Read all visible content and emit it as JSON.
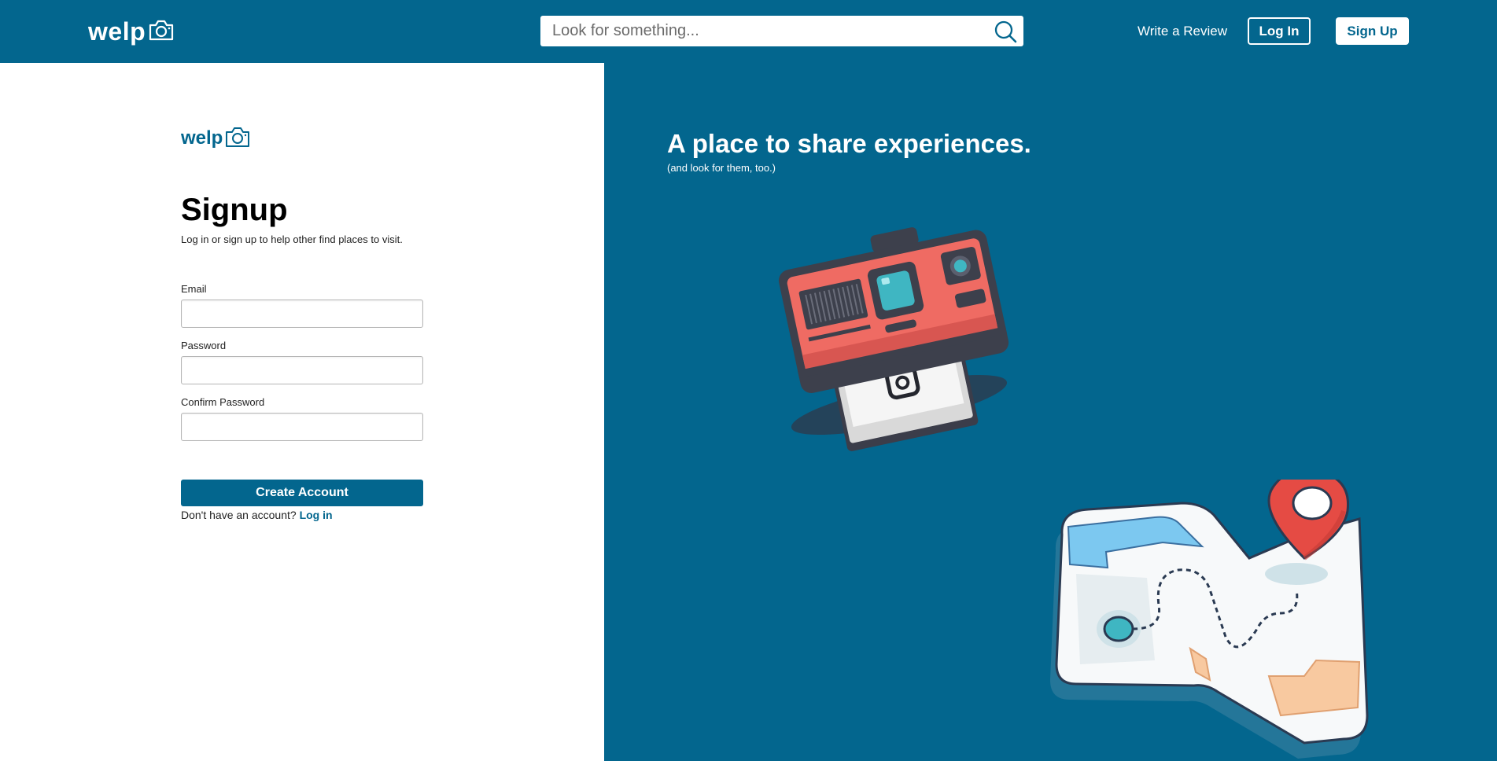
{
  "colors": {
    "brand": "#03668e",
    "white": "#ffffff"
  },
  "nav": {
    "logo": "welp",
    "logo_icon": "camera-icon",
    "search_placeholder": "Look for something...",
    "search_icon": "search-icon",
    "write_review": "Write a Review",
    "login": "Log In",
    "signup": "Sign Up"
  },
  "form": {
    "logo": "welp",
    "title": "Signup",
    "subtitle": "Log in or sign up to help other find places to visit.",
    "fields": [
      {
        "label": "Email",
        "value": ""
      },
      {
        "label": "Password",
        "value": ""
      },
      {
        "label": "Confirm Password",
        "value": ""
      }
    ],
    "submit": "Create Account",
    "no_account_text": "Don't have an account?",
    "login_link": "Log in"
  },
  "hero": {
    "title": "A place to share experiences.",
    "subtitle": "(and look for them, too.)"
  }
}
